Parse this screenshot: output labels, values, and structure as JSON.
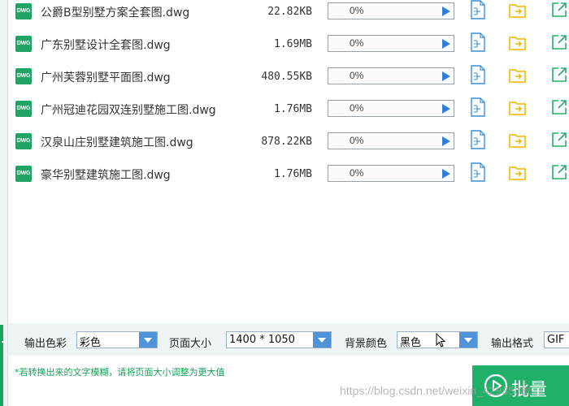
{
  "files": [
    {
      "name": "公爵B型别墅方案全套图.dwg",
      "size": "22.82KB",
      "progress": "0%",
      "progress_value": 0
    },
    {
      "name": "广东别墅设计全套图.dwg",
      "size": "1.69MB",
      "progress": "0%",
      "progress_value": 0
    },
    {
      "name": "广州芙蓉别墅平面图.dwg",
      "size": "480.55KB",
      "progress": "0%",
      "progress_value": 0
    },
    {
      "name": "广州冠迪花园双连别墅施工图.dwg",
      "size": "1.76MB",
      "progress": "0%",
      "progress_value": 0
    },
    {
      "name": "汉泉山庄别墅建筑施工图.dwg",
      "size": "878.22KB",
      "progress": "0%",
      "progress_value": 0
    },
    {
      "name": "豪华别墅建筑施工图.dwg",
      "size": "1.76MB",
      "progress": "0%",
      "progress_value": 0
    }
  ],
  "file_icon_text": "DWG",
  "icons": {
    "file": "file-preview-icon",
    "folder": "open-folder-icon",
    "open": "open-external-icon",
    "play": "play-icon"
  },
  "settings": {
    "color_label": "输出色彩",
    "color_value": "彩色",
    "page_size_label": "页面大小",
    "page_size_value": "1400 * 1050",
    "bg_label": "背景颜色",
    "bg_value": "黑色",
    "format_label": "输出格式",
    "format_value": "GIF"
  },
  "hint": "*若转换出来的文字模糊，请将页面大小调整为更大值",
  "batch_button": "批量",
  "watermark": "https://blog.csdn.net/weixin_42935086",
  "colors": {
    "accent_green": "#21b06a",
    "accent_blue": "#4f93d9",
    "folder_yellow": "#f0b400",
    "file_blue": "#3c8ddb"
  }
}
